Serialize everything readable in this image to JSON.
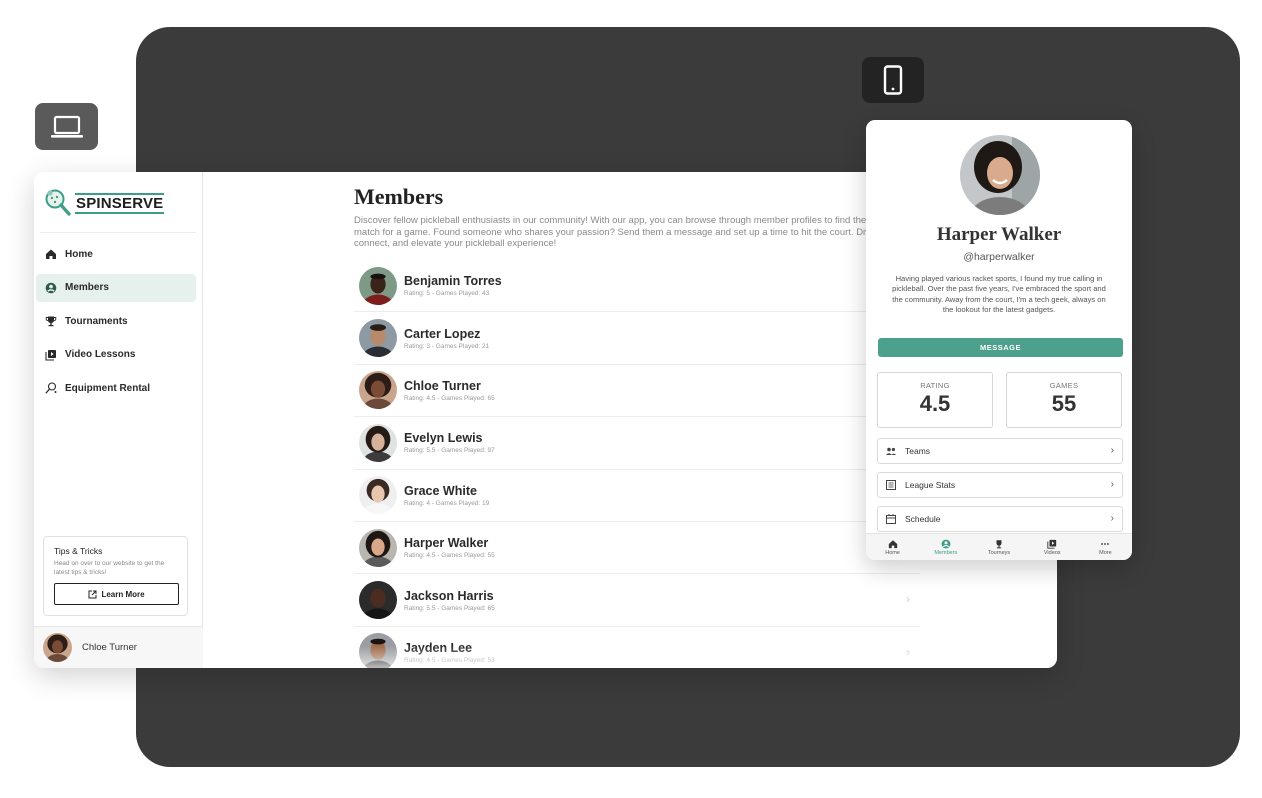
{
  "brand": {
    "name": "SPINSERVE",
    "accent": "#3d9d87"
  },
  "sidebar": {
    "items": [
      {
        "label": "Home",
        "icon": "home-icon"
      },
      {
        "label": "Members",
        "icon": "user-circle-icon",
        "active": true
      },
      {
        "label": "Tournaments",
        "icon": "trophy-icon"
      },
      {
        "label": "Video Lessons",
        "icon": "video-library-icon"
      },
      {
        "label": "Equipment Rental",
        "icon": "racket-icon"
      }
    ],
    "tips": {
      "title": "Tips & Tricks",
      "text": "Head on over to our website to get the latest tips & tricks!",
      "button": "Learn More"
    },
    "user": {
      "name": "Chloe Turner"
    }
  },
  "main": {
    "title": "Members",
    "description": "Discover fellow pickleball enthusiasts in our community! With our app, you can browse through member profiles to find the perfect match for a game. Found someone who shares your passion? Send them a message and set up a time to hit the court. Dive in, connect, and elevate your pickleball experience!",
    "members": [
      {
        "name": "Benjamin Torres",
        "meta": "Rating: 5 - Games Played: 43"
      },
      {
        "name": "Carter Lopez",
        "meta": "Rating: 3 - Games Played: 21"
      },
      {
        "name": "Chloe Turner",
        "meta": "Rating: 4.5 - Games Played: 65"
      },
      {
        "name": "Evelyn Lewis",
        "meta": "Rating: 5.5 - Games Played: 97"
      },
      {
        "name": "Grace White",
        "meta": "Rating: 4 - Games Played: 19"
      },
      {
        "name": "Harper Walker",
        "meta": "Rating: 4.5 - Games Played: 55"
      },
      {
        "name": "Jackson Harris",
        "meta": "Rating: 5.5 - Games Played: 65"
      },
      {
        "name": "Jayden Lee",
        "meta": "Rating: 4.5 - Games Played: 53"
      }
    ]
  },
  "profile": {
    "name": "Harper Walker",
    "handle": "@harperwalker",
    "bio": "Having played various racket sports, I found my true calling in pickleball. Over the past five years, I've embraced the sport and the community. Away from the court, I'm a tech geek, always on the lookout for the latest gadgets.",
    "message_label": "MESSAGE",
    "rating_label": "RATING",
    "rating_value": "4.5",
    "games_label": "GAMES",
    "games_value": "55",
    "links": [
      {
        "label": "Teams",
        "icon": "group-icon"
      },
      {
        "label": "League Stats",
        "icon": "list-icon"
      },
      {
        "label": "Schedule",
        "icon": "calendar-icon"
      }
    ],
    "bottom_nav": [
      {
        "label": "Home",
        "icon": "home-icon"
      },
      {
        "label": "Members",
        "icon": "user-circle-icon",
        "active": true
      },
      {
        "label": "Tourneys",
        "icon": "trophy-icon"
      },
      {
        "label": "Videos",
        "icon": "video-library-icon"
      },
      {
        "label": "More",
        "icon": "more-dots-icon"
      }
    ]
  }
}
